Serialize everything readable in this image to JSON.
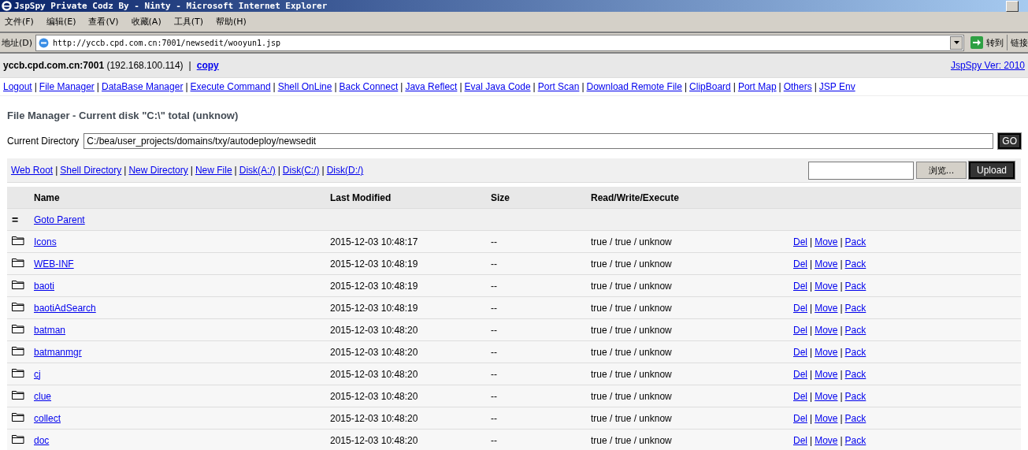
{
  "window": {
    "title": "JspSpy Private Codz By - Ninty - Microsoft Internet Explorer"
  },
  "menu": [
    "文件(F)",
    "编辑(E)",
    "查看(V)",
    "收藏(A)",
    "工具(T)",
    "帮助(H)"
  ],
  "address_bar": {
    "label": "地址(D)",
    "value": "http://yccb.cpd.com.cn:7001/newsedit/wooyun1.jsp",
    "go": "转到",
    "links": "链接"
  },
  "separator": "|",
  "header": {
    "host": "yccb.cpd.com.cn:7001",
    "ip": "(192.168.100.114)",
    "copy": "copy",
    "version": "JspSpy Ver: 2010"
  },
  "nav_links": [
    "Logout",
    "File Manager",
    "DataBase Manager",
    "Execute Command",
    "Shell OnLine",
    "Back Connect",
    "Java Reflect",
    "Eval Java Code",
    "Port Scan",
    "Download Remote File",
    "ClipBoard",
    "Port Map",
    "Others",
    "JSP Env"
  ],
  "heading": "File Manager - Current disk \"C:\\\" total (unknow)",
  "current_directory": {
    "label": "Current Directory",
    "value": "C:/bea/user_projects/domains/txy/autodeploy/newsedit",
    "go": "GO"
  },
  "toolbar_links": [
    "Web Root",
    "Shell Directory",
    "New Directory",
    "New File",
    "Disk(A:/)",
    "Disk(C:/)",
    "Disk(D:/)"
  ],
  "upload": {
    "browse": "浏览...",
    "button": "Upload"
  },
  "table": {
    "columns": [
      "Name",
      "Last Modified",
      "Size",
      "Read/Write/Execute"
    ],
    "parent": {
      "icon": "=",
      "label": "Goto Parent"
    },
    "rows": [
      {
        "name": "Icons",
        "modified": "2015-12-03 10:48:17",
        "size": "--",
        "rwx": "true / true / unknow",
        "actions": [
          "Del",
          "Move",
          "Pack"
        ]
      },
      {
        "name": "WEB-INF",
        "modified": "2015-12-03 10:48:19",
        "size": "--",
        "rwx": "true / true / unknow",
        "actions": [
          "Del",
          "Move",
          "Pack"
        ]
      },
      {
        "name": "baoti",
        "modified": "2015-12-03 10:48:19",
        "size": "--",
        "rwx": "true / true / unknow",
        "actions": [
          "Del",
          "Move",
          "Pack"
        ]
      },
      {
        "name": "baotiAdSearch",
        "modified": "2015-12-03 10:48:19",
        "size": "--",
        "rwx": "true / true / unknow",
        "actions": [
          "Del",
          "Move",
          "Pack"
        ]
      },
      {
        "name": "batman",
        "modified": "2015-12-03 10:48:20",
        "size": "--",
        "rwx": "true / true / unknow",
        "actions": [
          "Del",
          "Move",
          "Pack"
        ]
      },
      {
        "name": "batmanmgr",
        "modified": "2015-12-03 10:48:20",
        "size": "--",
        "rwx": "true / true / unknow",
        "actions": [
          "Del",
          "Move",
          "Pack"
        ]
      },
      {
        "name": "cj",
        "modified": "2015-12-03 10:48:20",
        "size": "--",
        "rwx": "true / true / unknow",
        "actions": [
          "Del",
          "Move",
          "Pack"
        ]
      },
      {
        "name": "clue",
        "modified": "2015-12-03 10:48:20",
        "size": "--",
        "rwx": "true / true / unknow",
        "actions": [
          "Del",
          "Move",
          "Pack"
        ]
      },
      {
        "name": "collect",
        "modified": "2015-12-03 10:48:20",
        "size": "--",
        "rwx": "true / true / unknow",
        "actions": [
          "Del",
          "Move",
          "Pack"
        ]
      },
      {
        "name": "doc",
        "modified": "2015-12-03 10:48:20",
        "size": "--",
        "rwx": "true / true / unknow",
        "actions": [
          "Del",
          "Move",
          "Pack"
        ]
      }
    ]
  }
}
